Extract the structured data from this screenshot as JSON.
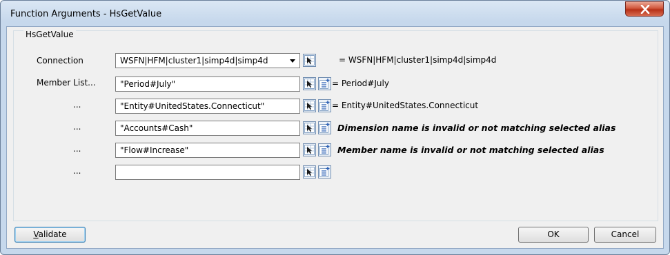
{
  "window": {
    "title": "Function Arguments - HsGetValue"
  },
  "group": {
    "label": "HsGetValue"
  },
  "rows": [
    {
      "label": "Connection",
      "value": "WSFN|HFM|cluster1|simp4d|simp4d",
      "result": "= WSFN|HFM|cluster1|simp4d|simp4d"
    },
    {
      "label": "Member List...",
      "value": "\"Period#July\"",
      "result": "= Period#July"
    },
    {
      "label": "...",
      "value": "\"Entity#UnitedStates.Connecticut\"",
      "result": "= Entity#UnitedStates.Connecticut"
    },
    {
      "label": "...",
      "value": "\"Accounts#Cash\"",
      "result": "Dimension name is invalid or not matching selected alias"
    },
    {
      "label": "...",
      "value": "\"Flow#Increase\"",
      "result": "Member name is invalid or not matching selected alias"
    },
    {
      "label": "...",
      "value": "",
      "result": ""
    }
  ],
  "buttons": {
    "validate_first": "V",
    "validate_rest": "alidate",
    "ok": "OK",
    "cancel": "Cancel"
  },
  "icons": {
    "close": "close-icon",
    "member_select": "member-select-icon",
    "add_member": "add-member-icon"
  },
  "colors": {
    "close_red": "#c8452a",
    "accent_blue": "#2b5fb3"
  }
}
